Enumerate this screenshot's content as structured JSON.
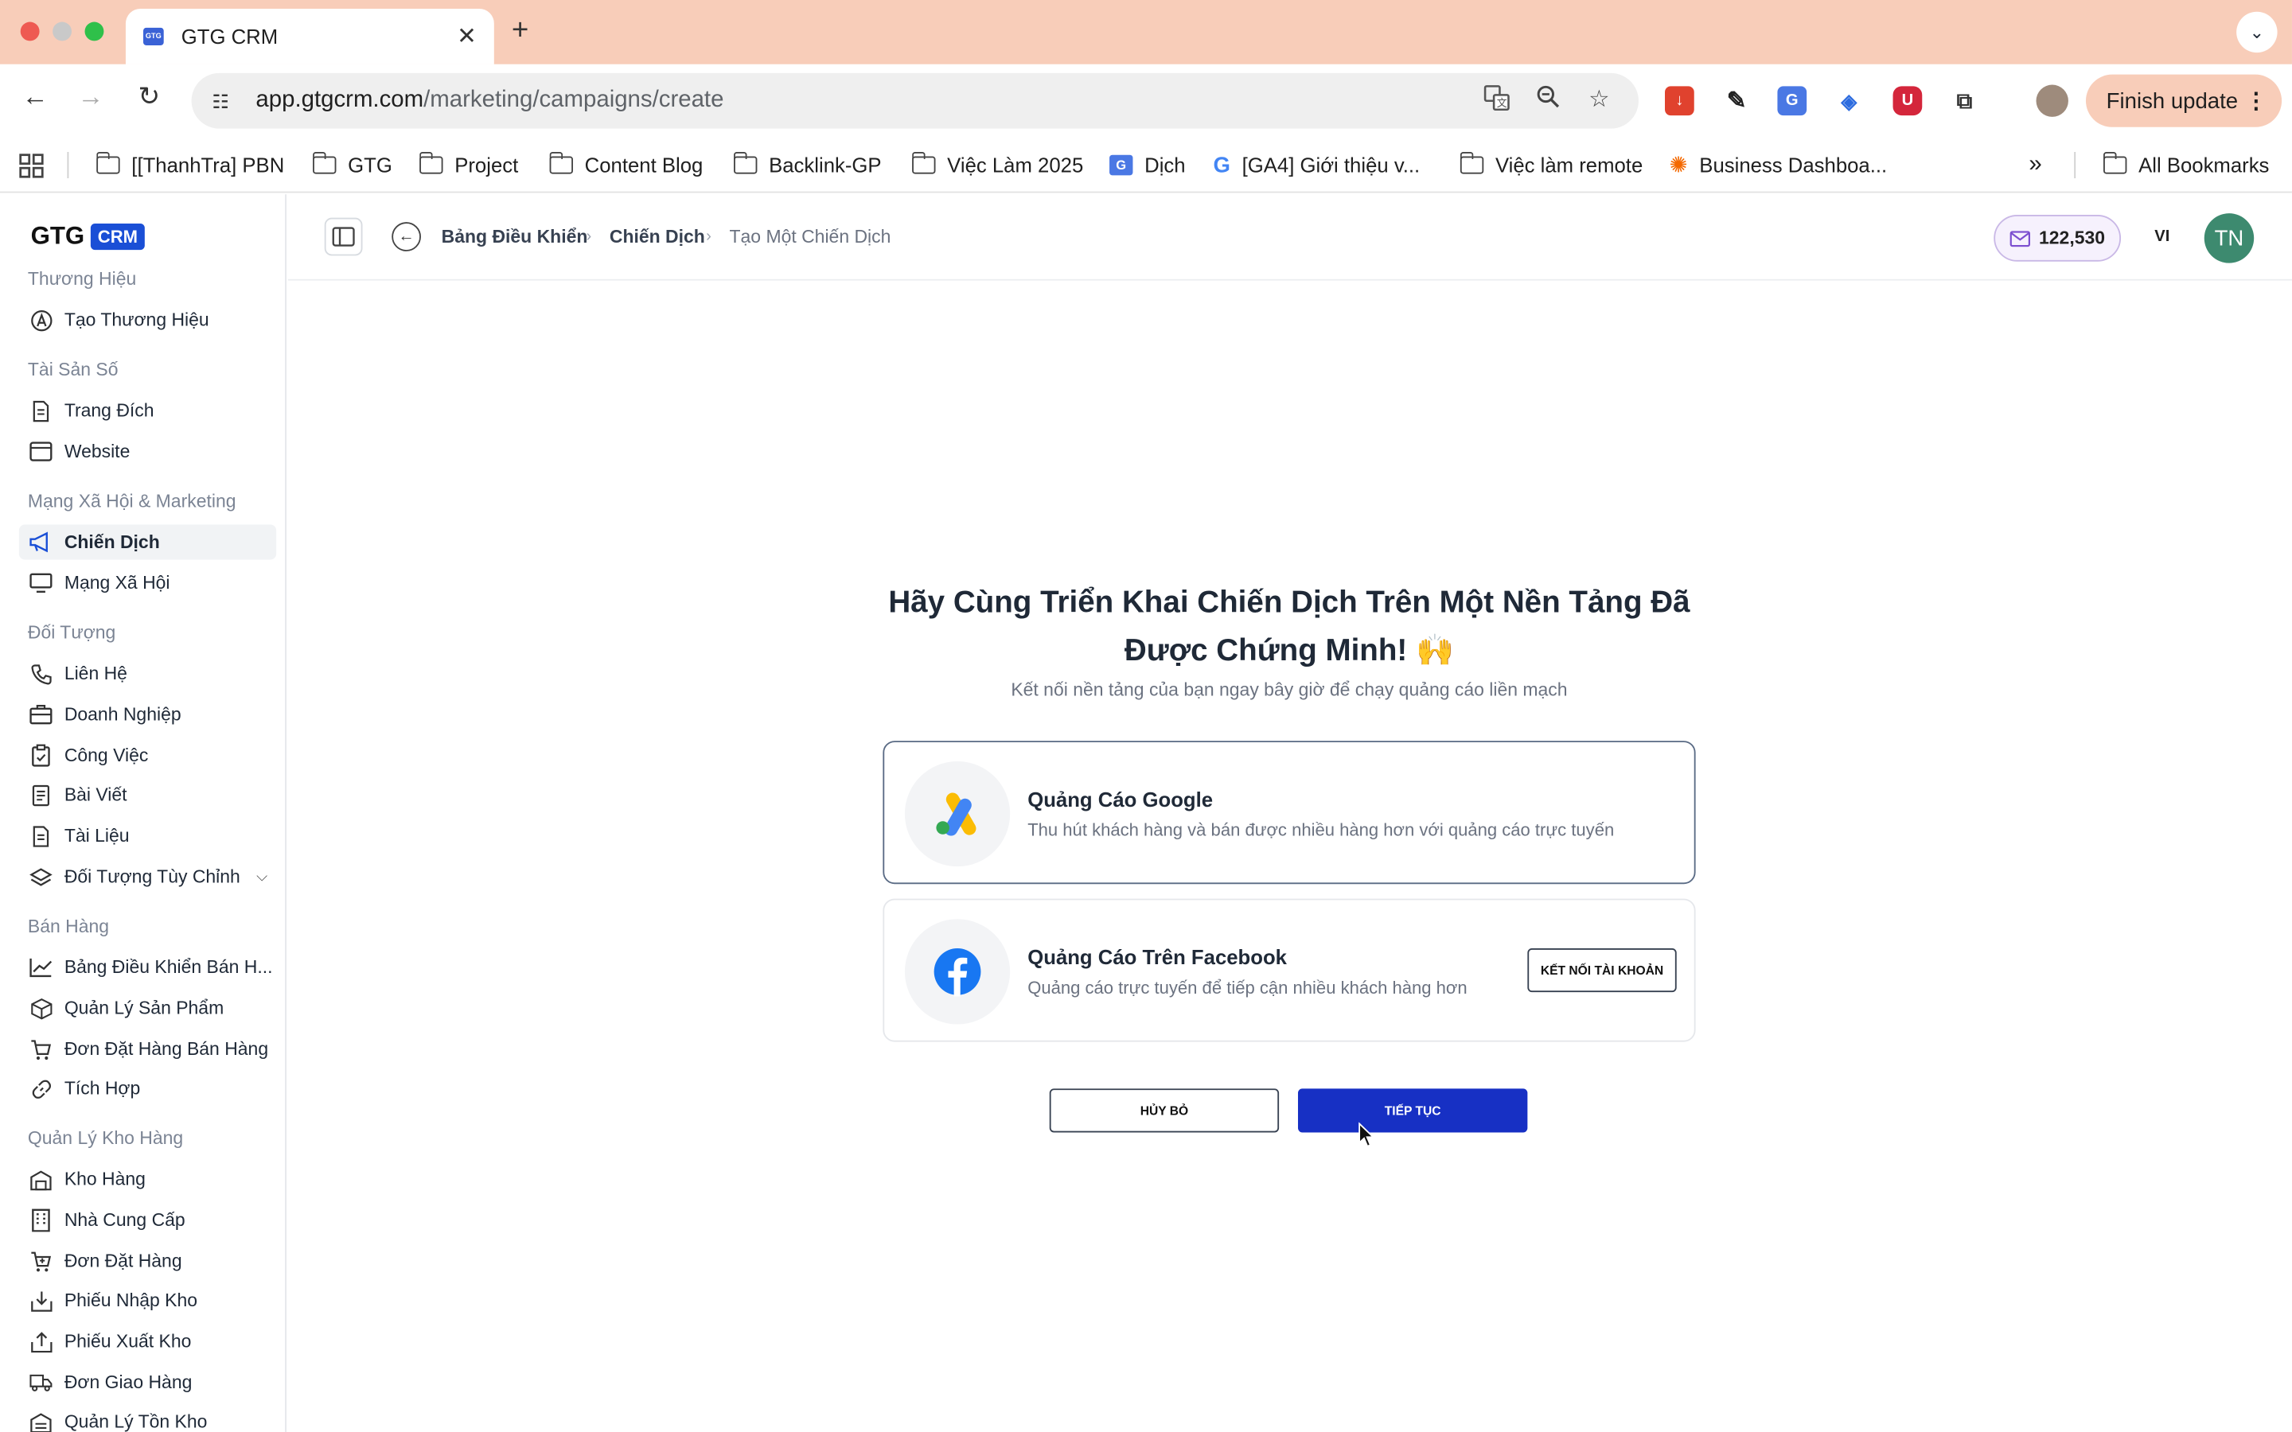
{
  "browser": {
    "tab_title": "GTG CRM",
    "tab_favicon_text": "GTG",
    "url_host": "app.gtgcrm.com",
    "url_path": "/marketing/campaigns/create",
    "finish_update": "Finish update",
    "bookmarks": [
      {
        "label": "[[ThanhTra] PBN",
        "icon": "folder-icon"
      },
      {
        "label": "GTG",
        "icon": "folder-icon"
      },
      {
        "label": "Project",
        "icon": "folder-icon"
      },
      {
        "label": "Content Blog",
        "icon": "folder-icon"
      },
      {
        "label": "Backlink-GP",
        "icon": "folder-icon"
      },
      {
        "label": "Việc Làm 2025",
        "icon": "folder-icon"
      },
      {
        "label": "Dịch",
        "icon": "translate-icon"
      },
      {
        "label": "[GA4] Giới thiệu v...",
        "icon": "google-icon"
      },
      {
        "label": "Việc làm remote",
        "icon": "folder-icon"
      },
      {
        "label": "Business Dashboa...",
        "icon": "grafana-icon"
      }
    ],
    "all_bookmarks": "All Bookmarks"
  },
  "sidebar": {
    "logo_text": "GTG",
    "logo_badge": "CRM",
    "sections": [
      {
        "title": "Thương Hiệu",
        "items": [
          {
            "label": "Tạo Thương Hiệu",
            "icon": "brand-icon"
          }
        ]
      },
      {
        "title": "Tài Sản Số",
        "items": [
          {
            "label": "Trang Đích",
            "icon": "document-icon"
          },
          {
            "label": "Website",
            "icon": "browser-icon"
          }
        ]
      },
      {
        "title": "Mạng Xã Hội & Marketing",
        "items": [
          {
            "label": "Chiến Dịch",
            "icon": "megaphone-icon",
            "active": true
          },
          {
            "label": "Mạng Xã Hội",
            "icon": "monitor-icon"
          }
        ]
      },
      {
        "title": "Đối Tượng",
        "items": [
          {
            "label": "Liên Hệ",
            "icon": "phone-icon"
          },
          {
            "label": "Doanh Nghiệp",
            "icon": "briefcase-icon"
          },
          {
            "label": "Công Việc",
            "icon": "clipboard-icon"
          },
          {
            "label": "Bài Viết",
            "icon": "article-icon"
          },
          {
            "label": "Tài Liệu",
            "icon": "document-icon"
          },
          {
            "label": "Đối Tượng Tùy Chỉnh",
            "icon": "layers-icon",
            "expandable": true
          }
        ]
      },
      {
        "title": "Bán Hàng",
        "items": [
          {
            "label": "Bảng Điều Khiển Bán H...",
            "icon": "chart-icon"
          },
          {
            "label": "Quản Lý Sản Phẩm",
            "icon": "box-icon"
          },
          {
            "label": "Đơn Đặt Hàng Bán Hàng",
            "icon": "cart-icon"
          },
          {
            "label": "Tích Hợp",
            "icon": "link-icon"
          }
        ]
      },
      {
        "title": "Quản Lý Kho Hàng",
        "items": [
          {
            "label": "Kho Hàng",
            "icon": "warehouse-icon"
          },
          {
            "label": "Nhà Cung Cấp",
            "icon": "building-icon"
          },
          {
            "label": "Đơn Đặt Hàng",
            "icon": "cart-plus-icon"
          },
          {
            "label": "Phiếu Nhập Kho",
            "icon": "import-icon"
          },
          {
            "label": "Phiếu Xuất Kho",
            "icon": "export-icon"
          },
          {
            "label": "Đơn Giao Hàng",
            "icon": "truck-icon"
          },
          {
            "label": "Quản Lý Tồn Kho",
            "icon": "inventory-icon"
          }
        ]
      }
    ]
  },
  "header": {
    "breadcrumbs": [
      "Bảng Điều Khiển",
      "Chiến Dịch",
      "Tạo Một Chiến Dịch"
    ],
    "credits": "122,530",
    "language": "VI",
    "avatar_initials": "TN"
  },
  "main": {
    "title_line1": "Hãy Cùng Triển Khai Chiến Dịch Trên Một Nền Tảng Đã",
    "title_line2": "Được Chứng Minh! 🙌",
    "subtitle": "Kết nối nền tảng của bạn ngay bây giờ để chạy quảng cáo liền mạch",
    "platforms": [
      {
        "title": "Quảng Cáo Google",
        "description": "Thu hút khách hàng và bán được nhiều hàng hơn với quảng cáo trực tuyến",
        "icon": "google-ads-icon",
        "selected": true
      },
      {
        "title": "Quảng Cáo Trên Facebook",
        "description": "Quảng cáo trực tuyến để tiếp cận nhiều khách hàng hơn",
        "icon": "facebook-icon",
        "action": "KẾT NỐI TÀI KHOẢN"
      }
    ],
    "cancel_label": "HỦY BỎ",
    "continue_label": "TIẾP TỤC"
  },
  "colors": {
    "accent": "#1730c4",
    "brand": "#1a4fd6",
    "tabstrip": "#f8cdb9"
  }
}
